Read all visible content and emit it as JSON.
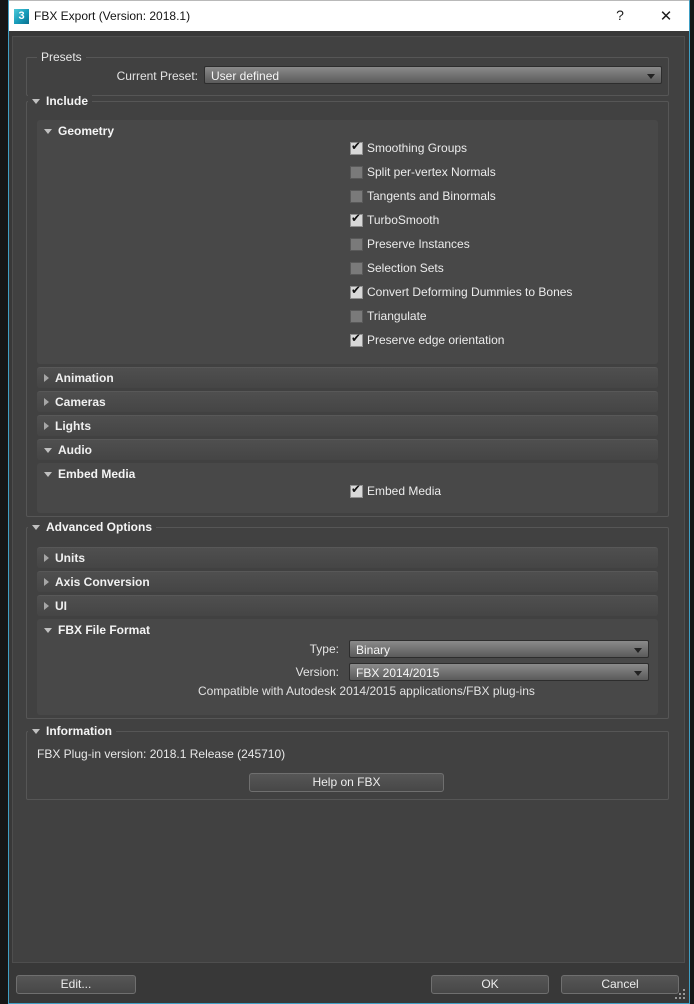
{
  "title_bar": {
    "title": "FBX Export (Version: 2018.1)",
    "icon_glyph": "3",
    "help_glyph": "?",
    "close_glyph": "✕"
  },
  "presets": {
    "legend": "Presets",
    "current_preset_label": "Current Preset:",
    "current_preset_value": "User defined"
  },
  "include": {
    "legend": "Include",
    "geometry": {
      "title": "Geometry",
      "checkboxes": [
        {
          "label": "Smoothing Groups",
          "checked": true
        },
        {
          "label": "Split per-vertex Normals",
          "checked": false
        },
        {
          "label": "Tangents and Binormals",
          "checked": false
        },
        {
          "label": "TurboSmooth",
          "checked": true
        },
        {
          "label": "Preserve Instances",
          "checked": false
        },
        {
          "label": "Selection Sets",
          "checked": false
        },
        {
          "label": "Convert Deforming Dummies to Bones",
          "checked": true
        },
        {
          "label": "Triangulate",
          "checked": false
        },
        {
          "label": "Preserve edge orientation",
          "checked": true
        }
      ]
    },
    "sections": [
      {
        "label": "Animation",
        "expanded": false
      },
      {
        "label": "Cameras",
        "expanded": false
      },
      {
        "label": "Lights",
        "expanded": false
      },
      {
        "label": "Audio",
        "expanded": true
      }
    ],
    "embed_media": {
      "title": "Embed Media",
      "checkbox": {
        "label": "Embed Media",
        "checked": true
      }
    }
  },
  "advanced_options": {
    "legend": "Advanced Options",
    "sections": [
      {
        "label": "Units",
        "expanded": false
      },
      {
        "label": "Axis Conversion",
        "expanded": false
      },
      {
        "label": "UI",
        "expanded": false
      }
    ],
    "fbx_file_format": {
      "title": "FBX File Format",
      "type_label": "Type:",
      "type_value": "Binary",
      "version_label": "Version:",
      "version_value": "FBX 2014/2015",
      "compatibility_note": "Compatible with Autodesk 2014/2015 applications/FBX plug-ins"
    }
  },
  "information": {
    "legend": "Information",
    "plugin_version_text": "FBX Plug-in version: 2018.1 Release (245710)",
    "help_button_label": "Help on FBX"
  },
  "footer": {
    "edit_label": "Edit...",
    "ok_label": "OK",
    "cancel_label": "Cancel"
  },
  "colors": {
    "window_border": "#3f9fc4",
    "titlebar_bg": "#ffffff",
    "dialog_bg": "#383838",
    "panel_bg": "#414141",
    "group_border": "#565656",
    "section_bar_bg": "#4a4a4a",
    "subpanel_bg": "#484848",
    "dropdown_gradient_top": "#8a8a8a",
    "dropdown_gradient_bottom": "#5a5a5a",
    "button_bg": "#4f4f4f",
    "checkbox_checked_bg": "#d8d8d8",
    "checkbox_unchecked_bg": "#7a7a7a",
    "app_icon_teal": "#169ab8",
    "text": "#ececec"
  }
}
